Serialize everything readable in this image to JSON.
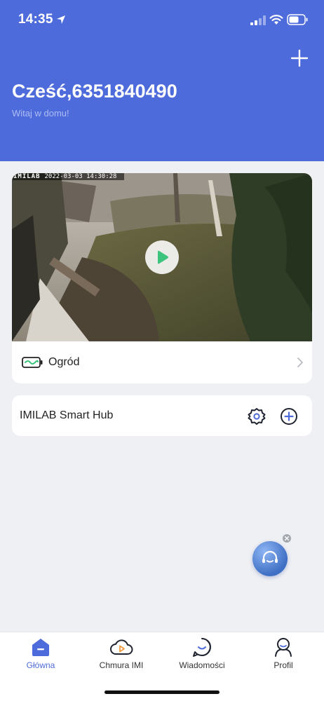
{
  "status_bar": {
    "time": "14:35"
  },
  "header": {
    "greeting": "Cześć,6351840490",
    "subtitle": "Witaj w domu!"
  },
  "camera": {
    "brand": "IMILAB",
    "timestamp": "2022-03-03 14:30:28",
    "name": "Ogród"
  },
  "hub": {
    "name": "IMILAB Smart Hub"
  },
  "tabs": [
    {
      "label": "Główna",
      "icon": "home-icon",
      "active": true
    },
    {
      "label": "Chmura IMI",
      "icon": "cloud-icon",
      "active": false
    },
    {
      "label": "Wiadomości",
      "icon": "message-icon",
      "active": false
    },
    {
      "label": "Profil",
      "icon": "profile-icon",
      "active": false
    }
  ],
  "colors": {
    "header_bg": "#4e6bdc",
    "accent": "#4e6bdc",
    "page_bg": "#eff0f4",
    "play_green": "#3cc47c"
  }
}
